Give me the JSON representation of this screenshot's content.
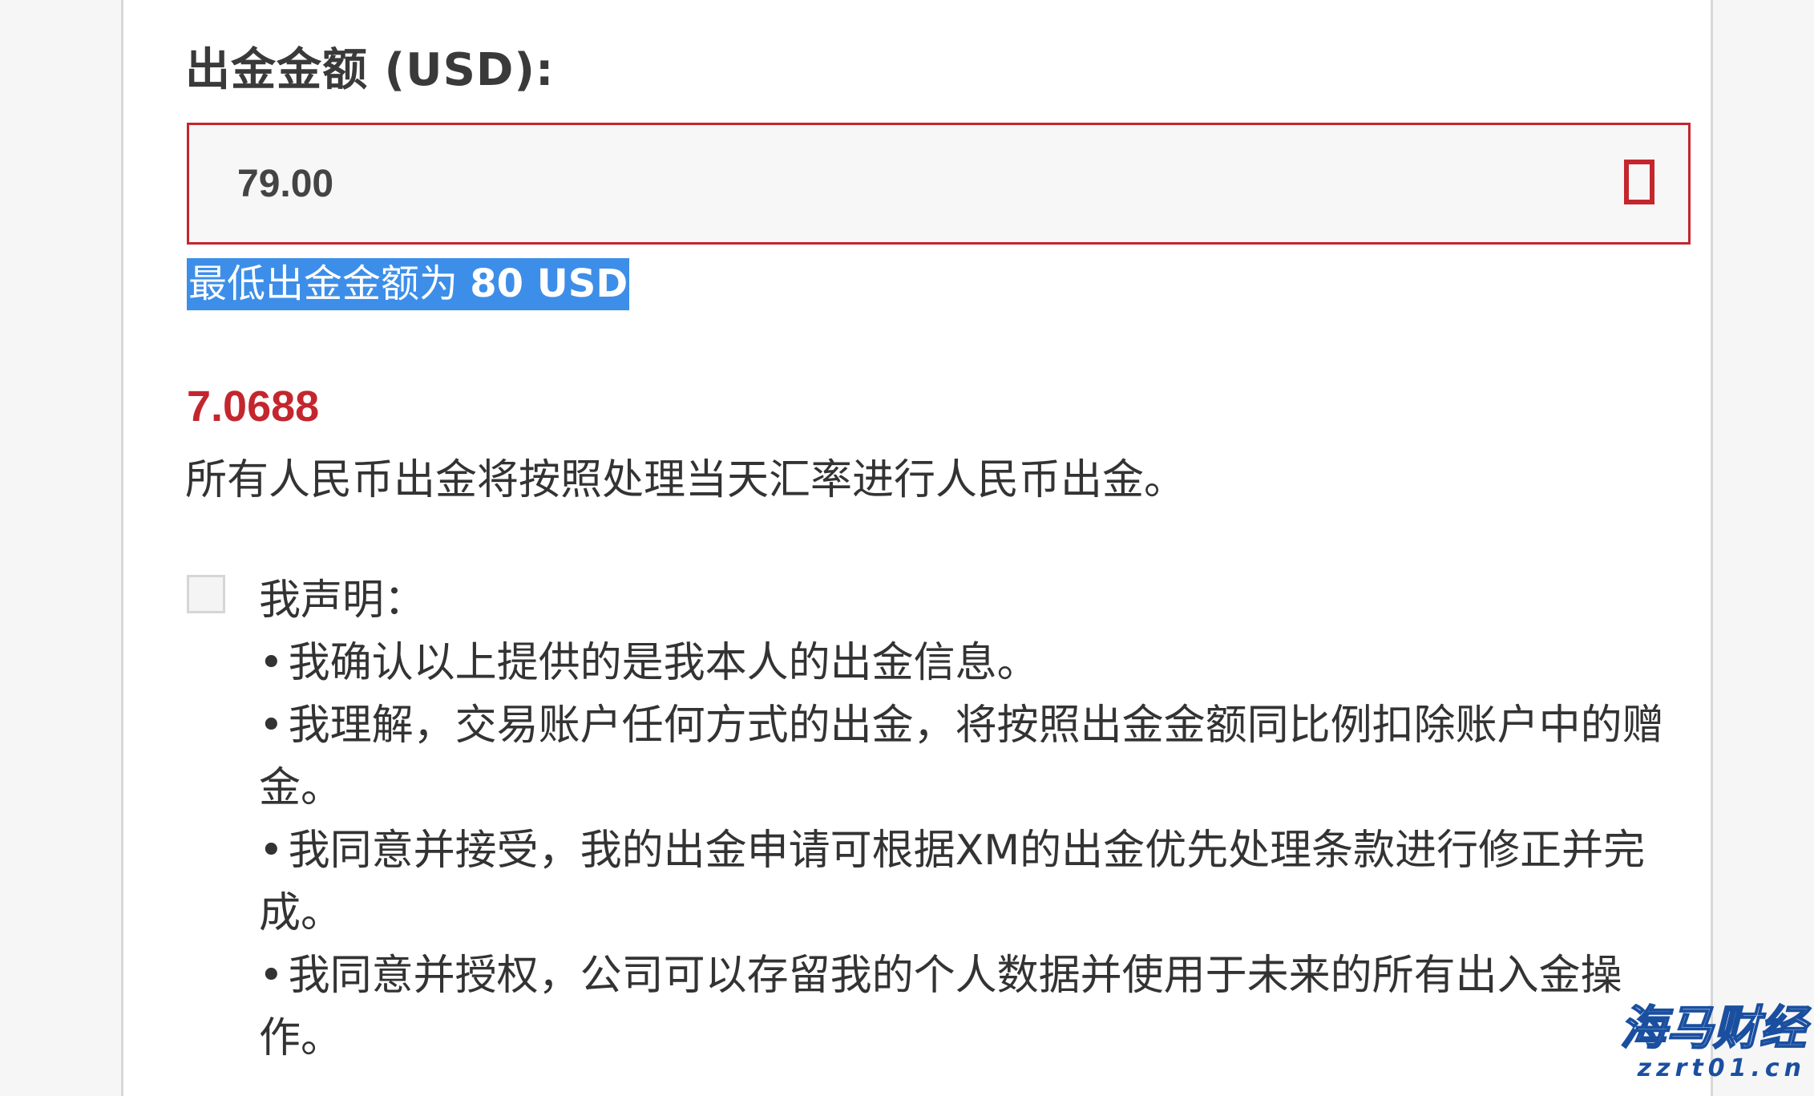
{
  "form": {
    "amount_label": "出金金额 (USD):",
    "amount_value": "79.00",
    "error_icon": "error-indicator-icon",
    "error_message_prefix": "最低出金金额为 ",
    "error_message_amount": "80 USD",
    "exchange_rate": "7.0688",
    "exchange_rate_note": "所有人民币出金将按照处理当天汇率进行人民币出金。",
    "declaration": {
      "checked": false,
      "title": "我声明：",
      "items": [
        "我确认以上提供的是我本人的出金信息。",
        "我理解，交易账户任何方式的出金，将按照出金金额同比例扣除账户中的赠金。",
        "我同意并接受，我的出金申请可根据XM的出金优先处理条款进行修正并完成。",
        "我同意并授权，公司可以存留我的个人数据并使用于未来的所有出入金操作。"
      ]
    }
  },
  "watermark": {
    "main": "海马财经",
    "sub": "zzrt01.cn"
  },
  "colors": {
    "accent_red": "#c4262e",
    "selection_blue": "#3d8ee8",
    "text": "#333333"
  }
}
